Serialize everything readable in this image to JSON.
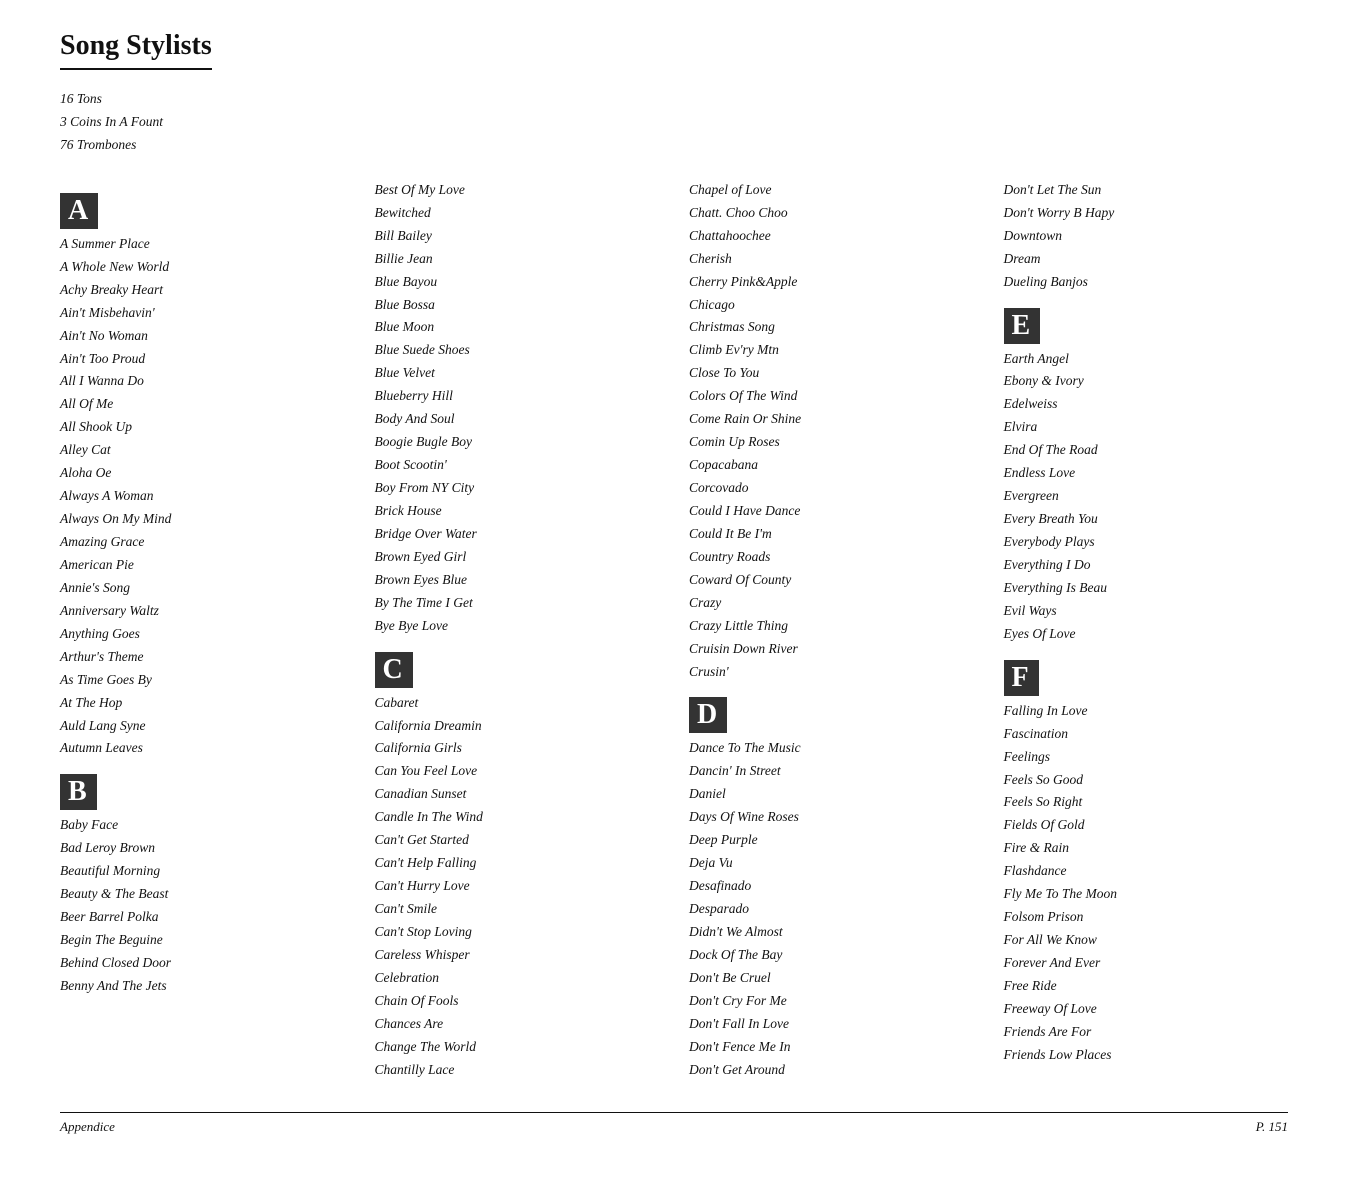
{
  "title": "Song Stylists",
  "footer": {
    "left": "Appendice",
    "right": "P. 151"
  },
  "intro": [
    "16 Tons",
    "3 Coins In A Fount",
    "76 Trombones"
  ],
  "columns": [
    {
      "sections": [
        {
          "letter": "A",
          "songs": [
            "A Summer Place",
            "A Whole New World",
            "Achy Breaky Heart",
            "Ain't Misbehavin'",
            "Ain't No Woman",
            "Ain't Too Proud",
            "All I Wanna Do",
            "All Of Me",
            "All Shook Up",
            "Alley Cat",
            "Aloha Oe",
            "Always A Woman",
            "Always On My Mind",
            "Amazing Grace",
            "American Pie",
            "Annie's Song",
            "Anniversary Waltz",
            "Anything Goes",
            "Arthur's Theme",
            "As Time Goes By",
            "At The Hop",
            "Auld Lang Syne",
            "Autumn Leaves"
          ]
        },
        {
          "letter": "B",
          "songs": [
            "Baby Face",
            "Bad Leroy Brown",
            "Beautiful Morning",
            "Beauty & The Beast",
            "Beer Barrel Polka",
            "Begin The Beguine",
            "Behind Closed Door",
            "Benny And The Jets"
          ]
        }
      ]
    },
    {
      "sections": [
        {
          "letter": "",
          "songs": [
            "Best Of My Love",
            "Bewitched",
            "Bill Bailey",
            "Billie Jean",
            "Blue Bayou",
            "Blue Bossa",
            "Blue Moon",
            "Blue Suede Shoes",
            "Blue Velvet",
            "Blueberry Hill",
            "Body And Soul",
            "Boogie Bugle Boy",
            "Boot Scootin'",
            "Boy From NY City",
            "Brick House",
            "Bridge Over Water",
            "Brown Eyed Girl",
            "Brown Eyes Blue",
            "By The Time I Get",
            "Bye Bye Love"
          ]
        },
        {
          "letter": "C",
          "songs": [
            "Cabaret",
            "California Dreamin",
            "California Girls",
            "Can You Feel Love",
            "Canadian Sunset",
            "Candle In The Wind",
            "Can't Get Started",
            "Can't Help Falling",
            "Can't Hurry Love",
            "Can't Smile",
            "Can't Stop Loving",
            "Careless Whisper",
            "Celebration",
            "Chain Of Fools",
            "Chances Are",
            "Change The World",
            "Chantilly Lace"
          ]
        }
      ]
    },
    {
      "sections": [
        {
          "letter": "",
          "songs": [
            "Chapel of Love",
            "Chatt. Choo Choo",
            "Chattahoochee",
            "Cherish",
            "Cherry Pink&Apple",
            "Chicago",
            "Christmas Song",
            "Climb Ev'ry Mtn",
            "Close To You",
            "Colors Of The Wind",
            "Come Rain Or Shine",
            "Comin Up Roses",
            "Copacabana",
            "Corcovado",
            "Could I Have Dance",
            "Could It Be I'm",
            "Country Roads",
            "Coward Of County",
            "Crazy",
            "Crazy Little Thing",
            "Cruisin Down River",
            "Crusin'"
          ]
        },
        {
          "letter": "D",
          "songs": [
            "Dance To The Music",
            "Dancin' In Street",
            "Daniel",
            "Days Of Wine Roses",
            "Deep Purple",
            "Deja Vu",
            "Desafinado",
            "Desparado",
            "Didn't We Almost",
            "Dock Of The Bay",
            "Don't Be Cruel",
            "Don't Cry For Me",
            "Don't Fall In Love",
            "Don't Fence Me In",
            "Don't Get Around"
          ]
        }
      ]
    },
    {
      "sections": [
        {
          "letter": "",
          "songs": [
            "Don't Let The Sun",
            "Don't Worry B Hapy",
            "Downtown",
            "Dream",
            "Dueling Banjos"
          ]
        },
        {
          "letter": "E",
          "songs": [
            "Earth Angel",
            "Ebony & Ivory",
            "Edelweiss",
            "Elvira",
            "End Of The Road",
            "Endless Love",
            "Evergreen",
            "Every Breath You",
            "Everybody Plays",
            "Everything I Do",
            "Everything Is Beau",
            "Evil Ways",
            "Eyes Of Love"
          ]
        },
        {
          "letter": "F",
          "songs": [
            "Falling In Love",
            "Fascination",
            "Feelings",
            "Feels So Good",
            "Feels So Right",
            "Fields Of Gold",
            "Fire & Rain",
            "Flashdance",
            "Fly Me To The Moon",
            "Folsom Prison",
            "For All We Know",
            "Forever And Ever",
            "Free Ride",
            "Freeway Of Love",
            "Friends Are For",
            "Friends Low Places"
          ]
        }
      ]
    }
  ]
}
